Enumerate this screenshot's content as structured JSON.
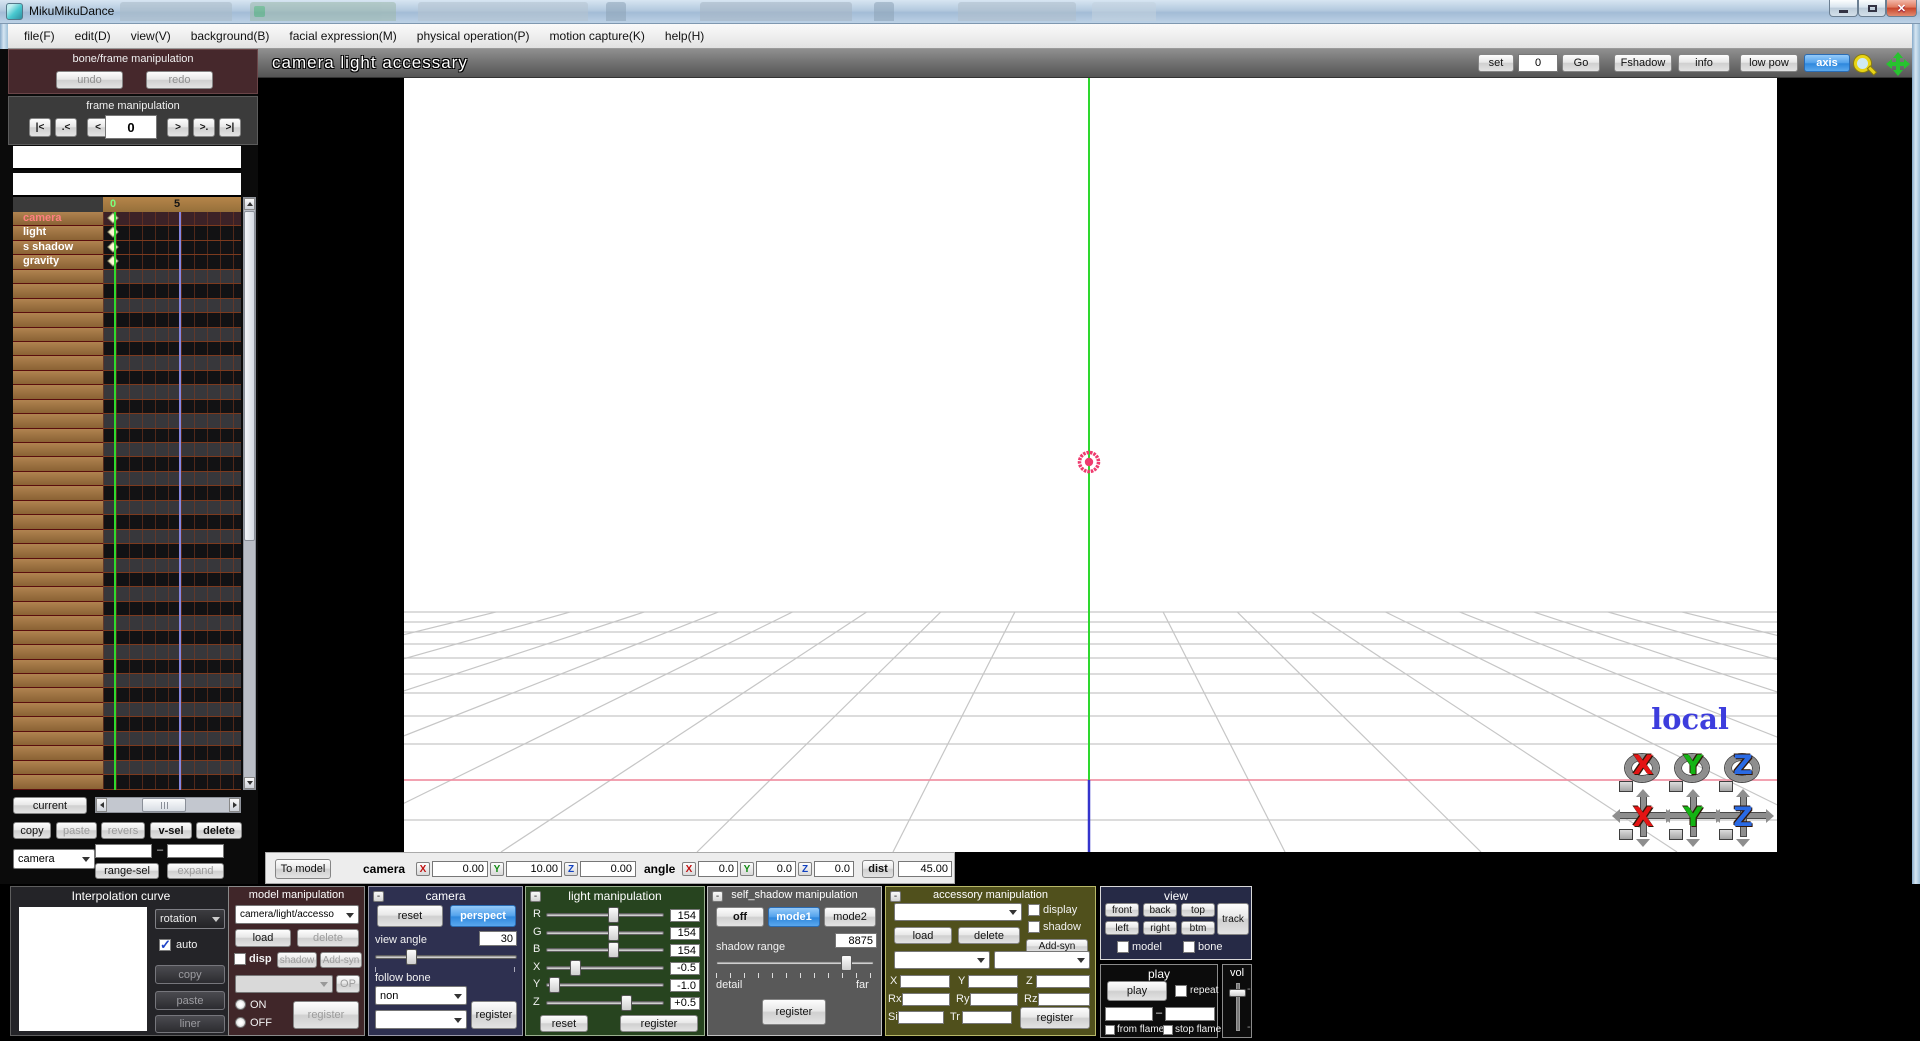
{
  "colors": {
    "accent_blue": "#4d9ce8",
    "titlebar_blue": "#b3c9de",
    "timeline_brown": "#a5793f",
    "maroon_panel": "#46282c",
    "navy_panel": "#2e3050",
    "green_panel": "#27441f",
    "olive_panel": "#50501c",
    "axis_green": "#2ed82e",
    "axis_red_line": "#f2889c",
    "axis_blue": "#3434cc",
    "target_pink": "#ee3a6e",
    "local_blue": "#3d3ddd",
    "keyframe_cream": "#faf3d2"
  },
  "titlebar": {
    "app_title": "MikuMikuDance",
    "window_buttons": [
      "minimize",
      "maximize",
      "close"
    ]
  },
  "menu": {
    "items": [
      "file(F)",
      "edit(D)",
      "view(V)",
      "background(B)",
      "facial expression(M)",
      "physical operation(P)",
      "motion capture(K)",
      "help(H)"
    ]
  },
  "left_panel": {
    "bone_frame": {
      "title": "bone/frame manipulation",
      "undo": "undo",
      "redo": "redo"
    },
    "frame_nav": {
      "title": "frame manipulation",
      "frame_value": "0",
      "buttons": [
        "|<",
        ".<",
        "<",
        ">",
        ">.",
        ">|"
      ]
    },
    "timeline": {
      "ticks": [
        {
          "label": "0",
          "color": "#7dff7d",
          "x": 7
        },
        {
          "label": "5",
          "color": "#141414",
          "x": 71
        }
      ],
      "tracks": [
        "camera",
        "light",
        "s shadow",
        "gravity"
      ],
      "empty_row_count": 36,
      "keyframe_rows": [
        0,
        1,
        2,
        3
      ]
    },
    "controls": {
      "current": "current",
      "copy": "copy",
      "paste": "paste",
      "revers": "revers",
      "v_sel": "v-sel",
      "delete": "delete",
      "target_select": "camera",
      "range_from": "",
      "range_to": "",
      "dash": "–",
      "range_sel": "range-sel",
      "expand": "expand"
    }
  },
  "viewport": {
    "mode_title": "camera light accessary",
    "toolbar": {
      "set": "set",
      "frame_value": "0",
      "go": "Go",
      "fshadow": "Fshadow",
      "info": "info",
      "low_pow": "low pow",
      "axis": "axis"
    },
    "local_label": "local",
    "axis_rotate_icons": [
      "X",
      "Y",
      "Z"
    ],
    "axis_move_icons": [
      "X",
      "Y",
      "Z"
    ]
  },
  "camera_bar": {
    "to_model": "To model",
    "camera_label": "camera",
    "x_label": "X",
    "x_value": "0.00",
    "y_label": "Y",
    "y_value": "10.00",
    "z_label": "Z",
    "z_value": "0.00",
    "angle_label": "angle",
    "ax_value": "0.0",
    "ay_value": "0.0",
    "az_value": "0.0",
    "dist_label": "dist",
    "dist_value": "45.00"
  },
  "panels": {
    "interpolation": {
      "title": "Interpolation curve",
      "mode_select": "rotation",
      "auto_label": "auto",
      "auto_checked": true,
      "copy": "copy",
      "paste": "paste",
      "liner": "liner"
    },
    "model_manipulation": {
      "title": "model manipulation",
      "model_select": "camera/light/accesso",
      "load": "load",
      "delete": "delete",
      "disp": "disp",
      "shadow": "shadow",
      "add_syn": "Add-syn",
      "op": "OP",
      "on": "ON",
      "off": "OFF",
      "register": "register"
    },
    "camera": {
      "title": "camera",
      "collapse": "-",
      "reset": "reset",
      "perspect": "perspect",
      "view_angle_label": "view angle",
      "view_angle_value": "30",
      "view_angle_pos": 0.24,
      "follow_bone_label": "follow bone",
      "follow_bone_select": "non",
      "register": "register"
    },
    "light": {
      "title": "light manipulation",
      "collapse": "-",
      "sliders": [
        {
          "label": "R",
          "value": "154",
          "pos": 0.58
        },
        {
          "label": "G",
          "value": "154",
          "pos": 0.58
        },
        {
          "label": "B",
          "value": "154",
          "pos": 0.58
        },
        {
          "label": "X",
          "value": "-0.5",
          "pos": 0.22
        },
        {
          "label": "Y",
          "value": "-1.0",
          "pos": 0.03
        },
        {
          "label": "Z",
          "value": "+0.5",
          "pos": 0.7
        }
      ],
      "reset": "reset",
      "register": "register"
    },
    "self_shadow": {
      "title": "self_shadow manipulation",
      "collapse": "-",
      "off": "off",
      "mode1": "mode1",
      "mode2": "mode2",
      "range_label": "shadow range",
      "range_value": "8875",
      "range_pos": 0.85,
      "detail": "detail",
      "far": "far",
      "register": "register"
    },
    "accessory": {
      "title": "accessory manipulation",
      "collapse": "-",
      "display": "display",
      "shadow": "shadow",
      "load": "load",
      "delete": "delete",
      "add_syn": "Add-syn",
      "fields": [
        "X",
        "Y",
        "Z",
        "Rx",
        "Ry",
        "Rz",
        "Si",
        "Tr"
      ],
      "register": "register"
    },
    "view": {
      "title": "view",
      "buttons": [
        "front",
        "back",
        "top",
        "left",
        "right",
        "btm"
      ],
      "track": "track",
      "model": "model",
      "bone": "bone"
    },
    "play": {
      "title": "play",
      "play": "play",
      "repeat": "repeat",
      "from_frame": "from flame",
      "stop_frame": "stop flame"
    },
    "vol": {
      "title": "vol"
    }
  }
}
